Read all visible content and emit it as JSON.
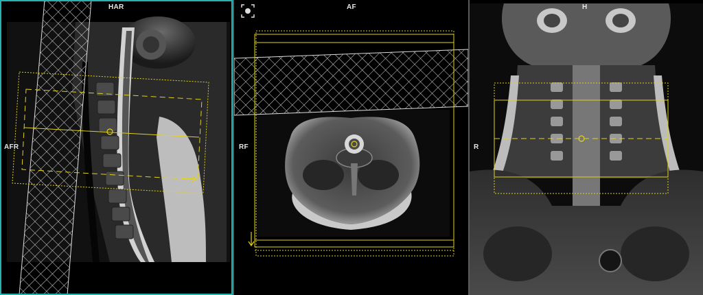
{
  "viewports": {
    "sagittal": {
      "top_label": "HAR",
      "left_label": "AFR",
      "active": true
    },
    "axial": {
      "top_label": "AF",
      "left_label": "RF"
    },
    "coronal": {
      "top_label": "H",
      "left_label": "R"
    }
  },
  "toolbar": {
    "tool_icon": "orientation-cube-icon"
  },
  "colors": {
    "active_border": "#23b3b3",
    "planning": "#e2d21c",
    "saturation_band": "#d8d8d8",
    "separator": "#5a5a5a"
  }
}
